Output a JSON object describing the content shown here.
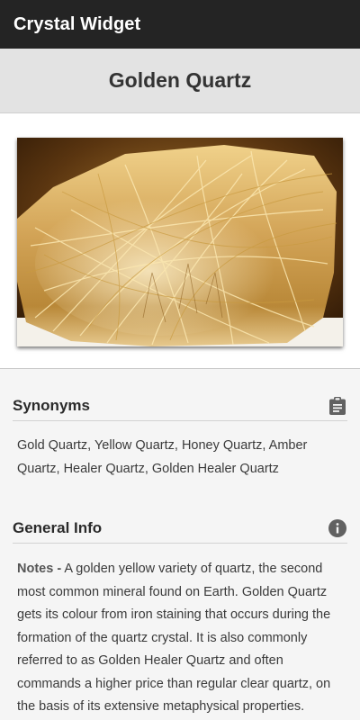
{
  "app": {
    "title": "Crystal Widget"
  },
  "crystal": {
    "name": "Golden Quartz",
    "image_alt": "Golden Quartz crystal photo"
  },
  "synonyms": {
    "heading": "Synonyms",
    "icon": "clipboard-icon",
    "text": "Gold Quartz, Yellow Quartz, Honey Quartz, Amber Quartz, Healer Quartz, Golden Healer Quartz"
  },
  "general_info": {
    "heading": "General Info",
    "icon": "info-icon",
    "notes_label": "Notes -",
    "notes_text": " A golden yellow variety of quartz, the second most common mineral found on Earth. Golden Quartz gets its colour from iron staining that occurs during the formation of the quartz crystal. It is also commonly referred to as Golden Healer Quartz and often commands a higher price than regular clear quartz, on the basis of its extensive metaphysical properties."
  },
  "colors": {
    "appbar": "#242424",
    "header": "#e3e3e3",
    "icon": "#616161",
    "gold": "#d9a84a"
  }
}
